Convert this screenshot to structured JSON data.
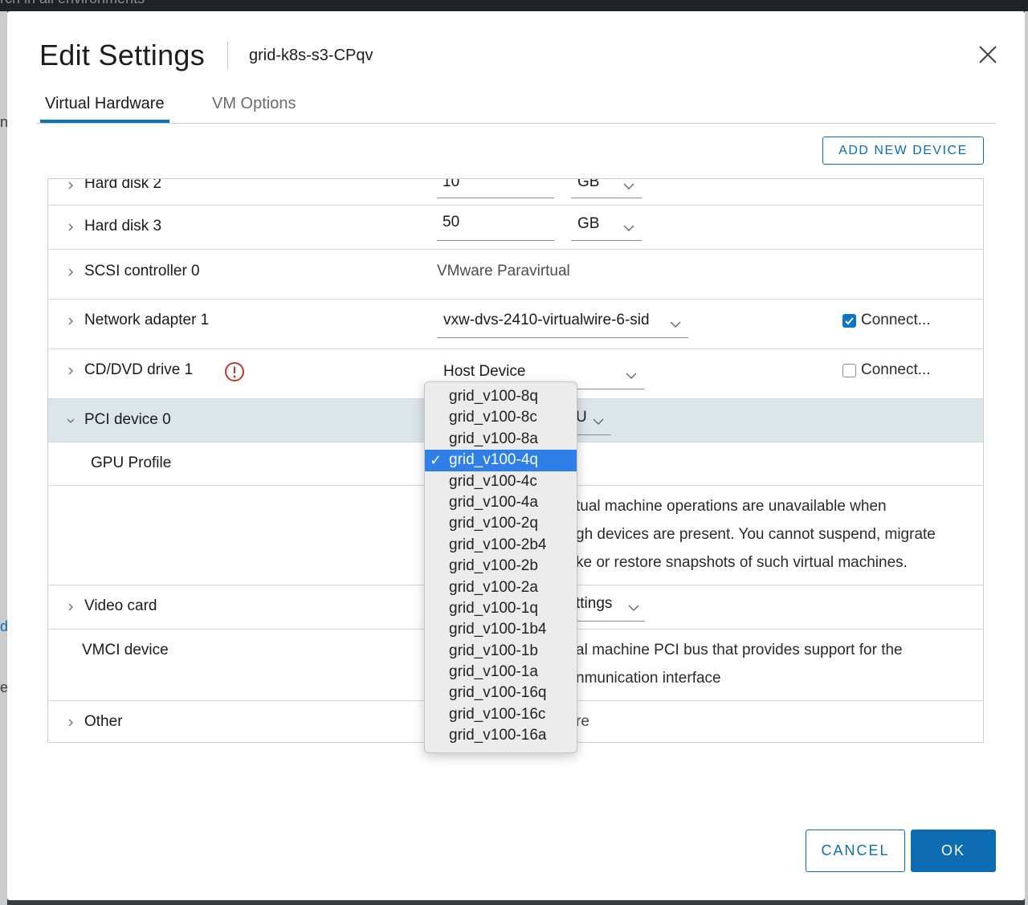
{
  "background": {
    "search_placeholder": "rch in all environments",
    "left_letters": [
      "n",
      "di",
      "el"
    ]
  },
  "dialog": {
    "title": "Edit Settings",
    "vm_name": "grid-k8s-s3-CPqv",
    "close_icon": "close-icon"
  },
  "tabs": [
    {
      "label": "Virtual Hardware",
      "active": true
    },
    {
      "label": "VM Options",
      "active": false
    }
  ],
  "add_device_label": "ADD NEW DEVICE",
  "hardware": {
    "hard_disk_2": {
      "label": "Hard disk 2",
      "size": "10",
      "unit": "GB"
    },
    "hard_disk_3": {
      "label": "Hard disk 3",
      "size": "50",
      "unit": "GB"
    },
    "scsi": {
      "label": "SCSI controller 0",
      "value": "VMware Paravirtual"
    },
    "network": {
      "label": "Network adapter 1",
      "value": "vxw-dvs-2410-virtualwire-6-sid",
      "connect_label": "Connect...",
      "connected": true
    },
    "cdrom": {
      "label": "CD/DVD drive 1",
      "value": "Host Device",
      "connect_label": "Connect...",
      "connected": false,
      "warning_icon": "warning-icon"
    },
    "pci": {
      "label": "PCI device 0",
      "value_visible": "U"
    },
    "gpu_profile": {
      "label": "GPU Profile"
    },
    "pci_note": {
      "line1": "tual machine operations are unavailable when",
      "line2": "gh devices are present. You cannot suspend, migrate",
      "line3": "ke or restore snapshots of such virtual machines."
    },
    "video": {
      "label": "Video card",
      "value_visible": "ttings"
    },
    "vmci": {
      "label": "VMCI device",
      "line1": "al machine PCI bus that provides support for the",
      "line2": "nmunication interface"
    },
    "other": {
      "label": "Other",
      "value_visible": "re"
    }
  },
  "gpu_profile_dropdown": {
    "selected": "grid_v100-4q",
    "options": [
      "grid_v100-8q",
      "grid_v100-8c",
      "grid_v100-8a",
      "grid_v100-4q",
      "grid_v100-4c",
      "grid_v100-4a",
      "grid_v100-2q",
      "grid_v100-2b4",
      "grid_v100-2b",
      "grid_v100-2a",
      "grid_v100-1q",
      "grid_v100-1b4",
      "grid_v100-1b",
      "grid_v100-1a",
      "grid_v100-16q",
      "grid_v100-16c",
      "grid_v100-16a"
    ],
    "check_glyph": "✓"
  },
  "footer": {
    "cancel_label": "CANCEL",
    "ok_label": "OK"
  },
  "colors": {
    "accent": "#0c6eb1",
    "selection": "#2f7fe9",
    "pci_row_bg": "#dbe5ec",
    "warning": "#c0392b"
  }
}
